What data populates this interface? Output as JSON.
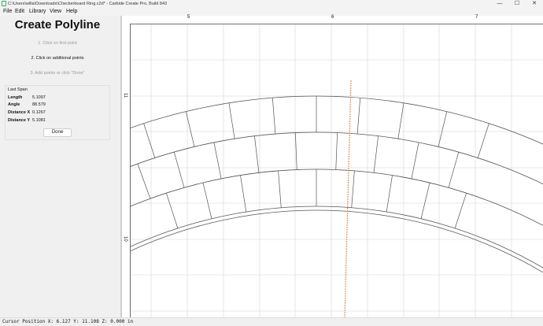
{
  "window": {
    "title": "C:\\Users\\willa\\Downloads\\Checkerboard Ring.c2d* - Carbide Create Pro, Build 843",
    "controls": {
      "minimize": "—",
      "maximize": "☐",
      "close": "✕"
    }
  },
  "menu": {
    "file": "File",
    "edit": "Edit",
    "library": "Library",
    "view": "View",
    "help": "Help"
  },
  "panel": {
    "title": "Create Polyline",
    "steps": [
      "1. Click on first point",
      "2. Click on additional points",
      "3. Add points or click \"Done\""
    ],
    "active_step": 1,
    "last_span": {
      "caption": "Last Span",
      "rows": [
        {
          "label": "Length",
          "value": "5.1097"
        },
        {
          "label": "Angle",
          "value": "88.579"
        },
        {
          "label": "Distance X",
          "value": "0.1267"
        },
        {
          "label": "Distance Y",
          "value": "5.1081"
        }
      ]
    },
    "done_label": "Done"
  },
  "rulers": {
    "x_labels": [
      "5",
      "6",
      "7"
    ],
    "y_labels": [
      "11",
      "10"
    ]
  },
  "status": {
    "text": "Cursor Position X: 6.127 Y: 11.108 Z: 0.000 in"
  },
  "colors": {
    "cursor_marker": "#e0301e",
    "polyline": "#e89060",
    "geometry": "#555555",
    "grid": "#d6d6d6"
  }
}
